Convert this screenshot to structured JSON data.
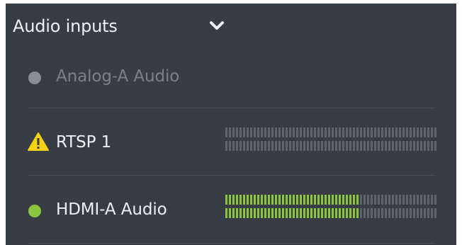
{
  "panel": {
    "title": "Audio inputs",
    "collapse_icon": "chevron-down-icon"
  },
  "inputs": [
    {
      "label": "Analog-A Audio",
      "status": "inactive",
      "status_icon": "status-dot-icon",
      "status_color": "#8a8e95",
      "label_color": "#7b8089",
      "meter": null
    },
    {
      "label": "RTSP 1",
      "status": "warning",
      "status_icon": "warning-icon",
      "status_color": "#f5d313",
      "label_color": "#eef0f2",
      "meter": {
        "level": 0.0
      }
    },
    {
      "label": "HDMI-A Audio",
      "status": "active",
      "status_icon": "status-dot-icon",
      "status_color": "#8cc63f",
      "label_color": "#eef0f2",
      "meter": {
        "level": 0.64
      }
    }
  ],
  "colors": {
    "panel_bg": "#373c45",
    "meter_off": "#5f646c",
    "meter_on": "#8cc63f"
  }
}
